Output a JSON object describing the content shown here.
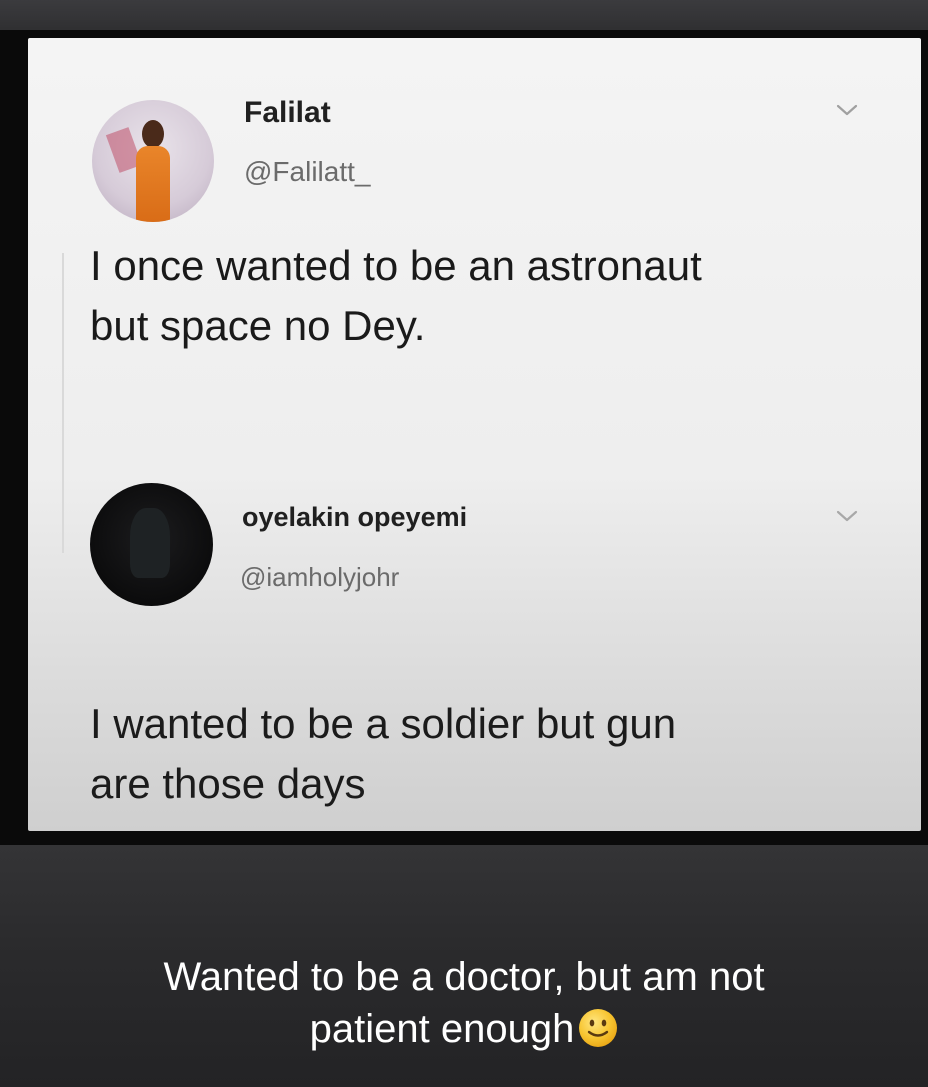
{
  "tweet_1": {
    "display_name": "Falilat",
    "handle": "@Falilatt_",
    "text": "I once wanted to be an astronaut\nbut space no Dey."
  },
  "tweet_2": {
    "display_name": "oyelakin opeyemi",
    "handle": "@iamholyjohr",
    "text": "I wanted to be a soldier but gun\nare those days"
  },
  "caption": {
    "line_1": "Wanted to be a doctor, but am not",
    "line_2": "patient enough",
    "emoji": "slightly-smiling-face-icon"
  },
  "colors": {
    "caption_background": "#2b2b2d",
    "card_background": "#f2f2f2",
    "text_primary": "#1a1a1a",
    "text_secondary": "#6b6b6b"
  }
}
